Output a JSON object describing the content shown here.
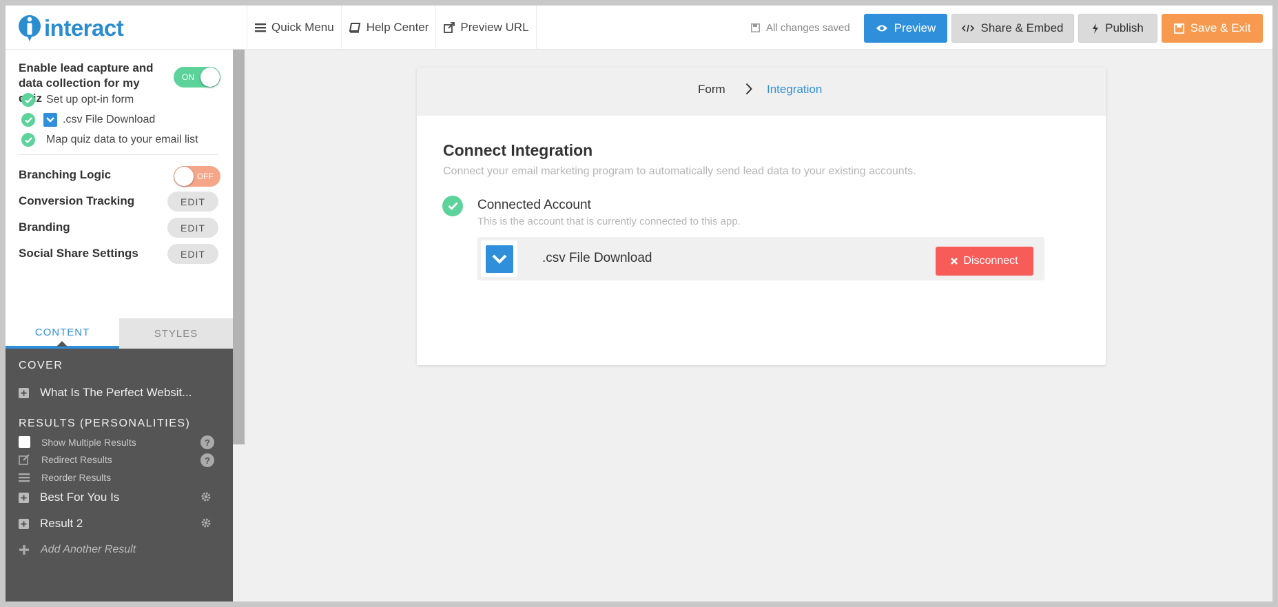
{
  "app": {
    "logo_text": "interact"
  },
  "topbar": {
    "nav": [
      {
        "label": "Quick Menu",
        "icon": "hamburger-icon"
      },
      {
        "label": "Help Center",
        "icon": "book-icon"
      },
      {
        "label": "Preview URL",
        "icon": "external-link-icon"
      }
    ],
    "save_status": "All changes saved",
    "buttons": {
      "preview": "Preview",
      "share": "Share & Embed",
      "publish": "Publish",
      "save_exit": "Save & Exit"
    }
  },
  "colors": {
    "accent_blue": "#2f8fdb",
    "success_green": "#5cd39b",
    "warning_orange": "#f79a50",
    "danger_red": "#f85c59",
    "sidebar_dark": "#555555"
  },
  "sidebar": {
    "lead_capture": {
      "title": "Enable lead capture and data collection for my quiz",
      "toggle_label": "ON",
      "enabled": true,
      "steps": [
        "Set up opt-in form",
        ".csv File Download",
        "Map quiz data to your email list"
      ]
    },
    "branching": {
      "label": "Branching Logic",
      "toggle_label": "OFF",
      "enabled": false
    },
    "settings": [
      {
        "label": "Conversion Tracking",
        "button": "EDIT"
      },
      {
        "label": "Branding",
        "button": "EDIT"
      },
      {
        "label": "Social Share Settings",
        "button": "EDIT"
      }
    ],
    "tabs": {
      "content": "CONTENT",
      "styles": "STYLES",
      "active": "CONTENT"
    },
    "cover": {
      "heading": "COVER",
      "item": "What Is The Perfect Websit..."
    },
    "results": {
      "heading": "RESULTS (PERSONALITIES)",
      "options": [
        "Show Multiple Results",
        "Redirect Results",
        "Reorder Results"
      ],
      "help_glyph": "?",
      "items": [
        "Best For You Is",
        "Result 2"
      ],
      "add": "Add Another Result"
    }
  },
  "main": {
    "breadcrumb": {
      "step1": "Form",
      "step2": "Integration"
    },
    "title": "Connect Integration",
    "subtitle": "Connect your email marketing program to automatically send lead data to your existing accounts.",
    "account": {
      "title": "Connected Account",
      "subtitle": "This is the account that is currently connected to this app.",
      "name": ".csv File Download",
      "disconnect": "Disconnect"
    }
  }
}
